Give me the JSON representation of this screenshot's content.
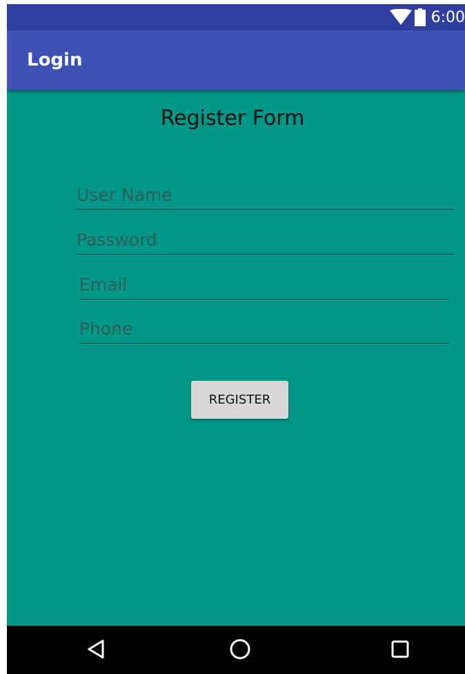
{
  "status_bar": {
    "time": "6:00",
    "icons": [
      "wifi-icon",
      "battery-icon"
    ]
  },
  "app_bar": {
    "title": "Login"
  },
  "form": {
    "title": "Register Form",
    "fields": {
      "username_placeholder": "User Name",
      "password_placeholder": "Password",
      "email_placeholder": "Email",
      "phone_placeholder": "Phone"
    },
    "register_label": "REGISTER"
  },
  "nav_bar": {
    "icons": [
      "back-icon",
      "home-icon",
      "recents-icon"
    ]
  },
  "colors": {
    "status_bar": "#303f9f",
    "app_bar": "#3f51b5",
    "background": "#009688",
    "button": "#d6d7d7",
    "nav_bar": "#000000"
  }
}
